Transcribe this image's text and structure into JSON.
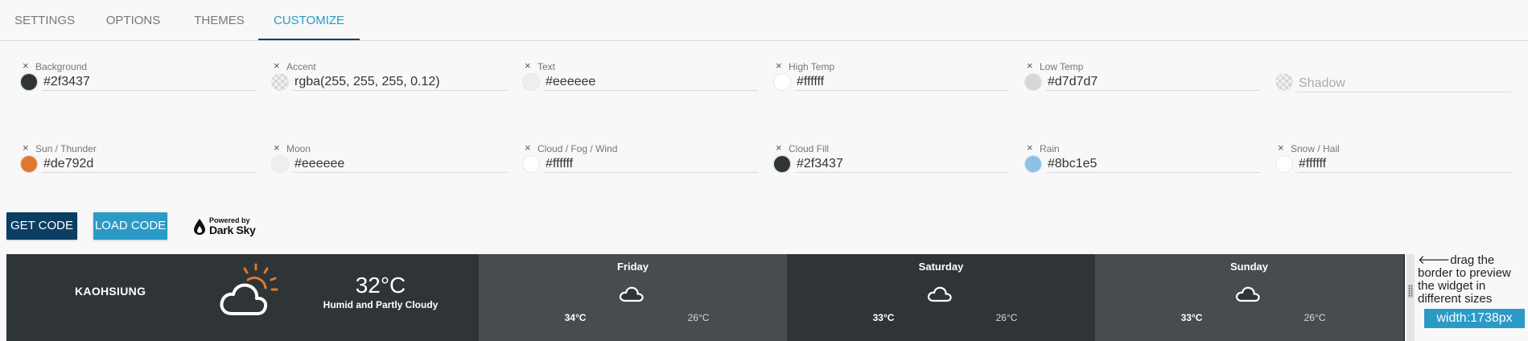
{
  "tabs": [
    {
      "label": "SETTINGS"
    },
    {
      "label": "OPTIONS"
    },
    {
      "label": "THEMES"
    },
    {
      "label": "CUSTOMIZE",
      "active": true
    }
  ],
  "colors": {
    "row1": [
      {
        "label": "Background",
        "value": "#2f3437",
        "swatch": "#2f3437"
      },
      {
        "label": "Accent",
        "value": "rgba(255, 255, 255, 0.12)",
        "swatch": "transparent"
      },
      {
        "label": "Text",
        "value": "#eeeeee",
        "swatch": "#eeeeee"
      },
      {
        "label": "High Temp",
        "value": "#ffffff",
        "swatch": "#ffffff"
      },
      {
        "label": "Low Temp",
        "value": "#d7d7d7",
        "swatch": "#d7d7d7"
      },
      {
        "label": "",
        "value": "",
        "placeholder": "Shadow",
        "swatch": "transparent"
      }
    ],
    "row2": [
      {
        "label": "Sun / Thunder",
        "value": "#de792d",
        "swatch": "#de792d"
      },
      {
        "label": "Moon",
        "value": "#eeeeee",
        "swatch": "#eeeeee"
      },
      {
        "label": "Cloud / Fog / Wind",
        "value": "#ffffff",
        "swatch": "#ffffff"
      },
      {
        "label": "Cloud Fill",
        "value": "#2f3437",
        "swatch": "#2f3437"
      },
      {
        "label": "Rain",
        "value": "#8bc1e5",
        "swatch": "#8bc1e5"
      },
      {
        "label": "Snow / Hail",
        "value": "#ffffff",
        "swatch": "#ffffff"
      }
    ],
    "clear_symbol": "×"
  },
  "buttons": {
    "get_code": "GET CODE",
    "load_code": "LOAD CODE"
  },
  "powered": {
    "line1": "Powered by",
    "line2": "Dark Sky"
  },
  "widget": {
    "city": "KAOHSIUNG",
    "current_temp": "32°C",
    "current_desc": "Humid and Partly Cloudy",
    "current_icon": "partly-cloudy-day-icon",
    "background": "#2f3437",
    "accent": "rgba(255, 255, 255, 0.12)",
    "sun_color": "#de792d",
    "days": [
      {
        "name": "Friday",
        "high": "34°C",
        "low": "26°C",
        "icon": "cloudy-icon"
      },
      {
        "name": "Saturday",
        "high": "33°C",
        "low": "26°C",
        "icon": "cloudy-icon"
      },
      {
        "name": "Sunday",
        "high": "33°C",
        "low": "26°C",
        "icon": "cloudy-icon"
      }
    ]
  },
  "resize": {
    "hint": "🡐drag the border to preview the widget in different sizes",
    "width_label": "width:1738px"
  }
}
